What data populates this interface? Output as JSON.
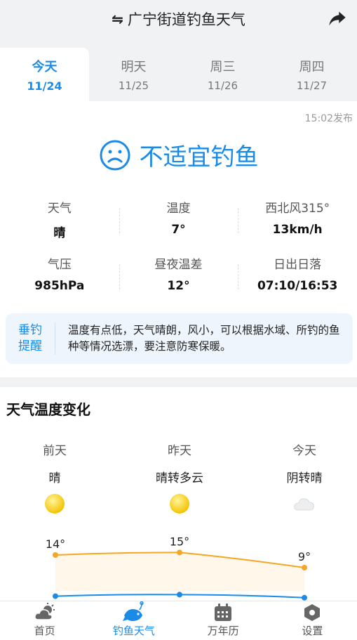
{
  "header": {
    "title": "广宁街道钓鱼天气",
    "swap_glyph": "⇋"
  },
  "tabs": [
    {
      "label": "今天",
      "date": "11/24",
      "active": true
    },
    {
      "label": "明天",
      "date": "11/25"
    },
    {
      "label": "周三",
      "date": "11/26"
    },
    {
      "label": "周四",
      "date": "11/27"
    }
  ],
  "publish_time": "15:02发布",
  "verdict": {
    "text": "不适宜钓鱼",
    "icon": "sad-face-icon",
    "color": "#1a8ce8"
  },
  "metrics": [
    {
      "label": "天气",
      "value": "晴"
    },
    {
      "label": "温度",
      "value": "7°"
    },
    {
      "label": "西北风315°",
      "value": "13km/h"
    },
    {
      "label": "气压",
      "value": "985hPa"
    },
    {
      "label": "昼夜温差",
      "value": "12°"
    },
    {
      "label": "日出日落",
      "value": "07:10/16:53"
    }
  ],
  "tip": {
    "tag_line1": "垂钓",
    "tag_line2": "提醒",
    "text": "温度有点低，天气晴朗，风小，可以根据水域、所钓的鱼种等情况选漂，要注意防寒保暖。"
  },
  "trend": {
    "title": "天气温度变化",
    "days": [
      {
        "name": "前天",
        "weather": "晴",
        "icon": "sun-icon"
      },
      {
        "name": "昨天",
        "weather": "晴转多云",
        "icon": "sun-icon"
      },
      {
        "name": "今天",
        "weather": "阴转晴",
        "icon": "cloud-icon"
      }
    ],
    "high_temps": [
      14,
      15,
      9
    ],
    "high_labels": [
      "14°",
      "15°",
      "9°"
    ],
    "low_temps": [
      2,
      3,
      1
    ]
  },
  "nav": [
    {
      "label": "首页",
      "icon": "weather-cloud-sun-icon"
    },
    {
      "label": "钓鱼天气",
      "icon": "fish-icon",
      "active": true
    },
    {
      "label": "万年历",
      "icon": "calendar-icon"
    },
    {
      "label": "设置",
      "icon": "settings-hexagon-icon"
    }
  ],
  "colors": {
    "accent": "#1a8ce8",
    "high_line": "#f5a623",
    "low_line": "#1a8ce8"
  }
}
